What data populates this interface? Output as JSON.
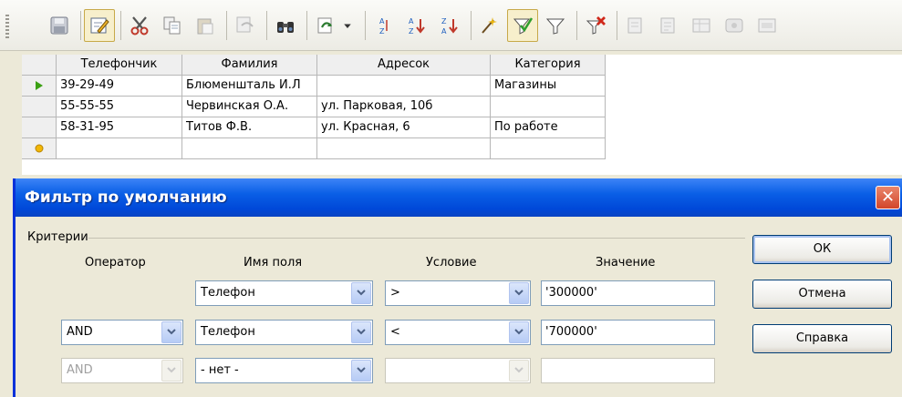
{
  "toolbar": {
    "icons": [
      "save-icon",
      "edit-icon",
      "cut-icon",
      "copy-icon",
      "paste-icon",
      "undo-icon",
      "find-icon",
      "refresh-icon",
      "dropdown-icon",
      "sort-icon",
      "sort-ascending-icon",
      "sort-descending-icon",
      "autofilter-icon",
      "default-filter-icon",
      "standard-filter-icon",
      "remove-filter-icon",
      "form-icon",
      "report-icon",
      "table-icon",
      "data-to-text-icon",
      "data-to-fields-icon"
    ]
  },
  "grid": {
    "columns": [
      "Телефончик",
      "Фамилия",
      "Адресок",
      "Категория"
    ],
    "rows": [
      [
        "39-29-49",
        "Блюменшталь И.Л",
        "",
        "Магазины"
      ],
      [
        "55-55-55",
        "Червинская О.А.",
        "ул. Парковая, 10б",
        ""
      ],
      [
        "58-31-95",
        "Титов Ф.В.",
        "ул. Красная, 6",
        "По работе"
      ],
      [
        "",
        "",
        "",
        ""
      ]
    ]
  },
  "dialog": {
    "title": "Фильтр по умолчанию",
    "close_label": "✕",
    "group_label": "Критерии",
    "col_operator": "Оператор",
    "col_field": "Имя поля",
    "col_condition": "Условие",
    "col_value": "Значение",
    "rows": [
      {
        "operator": "",
        "field": "Телефон",
        "condition": ">",
        "value": "'300000'"
      },
      {
        "operator": "AND",
        "field": "Телефон",
        "condition": "<",
        "value": "'700000'"
      },
      {
        "operator": "AND",
        "field": "- нет -",
        "condition": "",
        "value": ""
      }
    ],
    "ok_label": "ОК",
    "cancel_label": "Отмена",
    "help_label": "Справка"
  },
  "colors": {
    "titlebar": "#0a5fe6",
    "close": "#d2452a"
  }
}
